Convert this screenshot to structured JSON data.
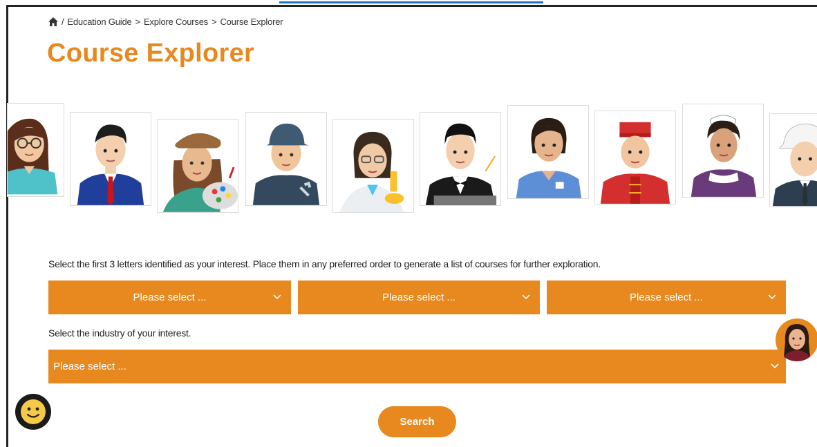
{
  "breadcrumb": {
    "home_icon": "home-icon",
    "sep": "/",
    "items": [
      "Education Guide",
      "Explore Courses",
      "Course Explorer"
    ],
    "arrow": ">"
  },
  "page_title": "Course Explorer",
  "avatars": [
    "woman-with-glasses",
    "businessman",
    "artist",
    "mechanic",
    "scientist",
    "waiter",
    "nurse",
    "bellhop",
    "housekeeper",
    "engineer"
  ],
  "interest": {
    "instruction": "Select the first 3 letters identified as your interest. Place them in any preferred order to generate a list of courses for further exploration.",
    "selects": [
      "Please select ...",
      "Please select ...",
      "Please select ..."
    ]
  },
  "industry": {
    "instruction": "Select the industry of your interest.",
    "select": "Please select ..."
  },
  "search_label": "Search",
  "colors": {
    "accent": "#e8891f",
    "text": "#222222",
    "link_underline": "#1f6fd1"
  }
}
